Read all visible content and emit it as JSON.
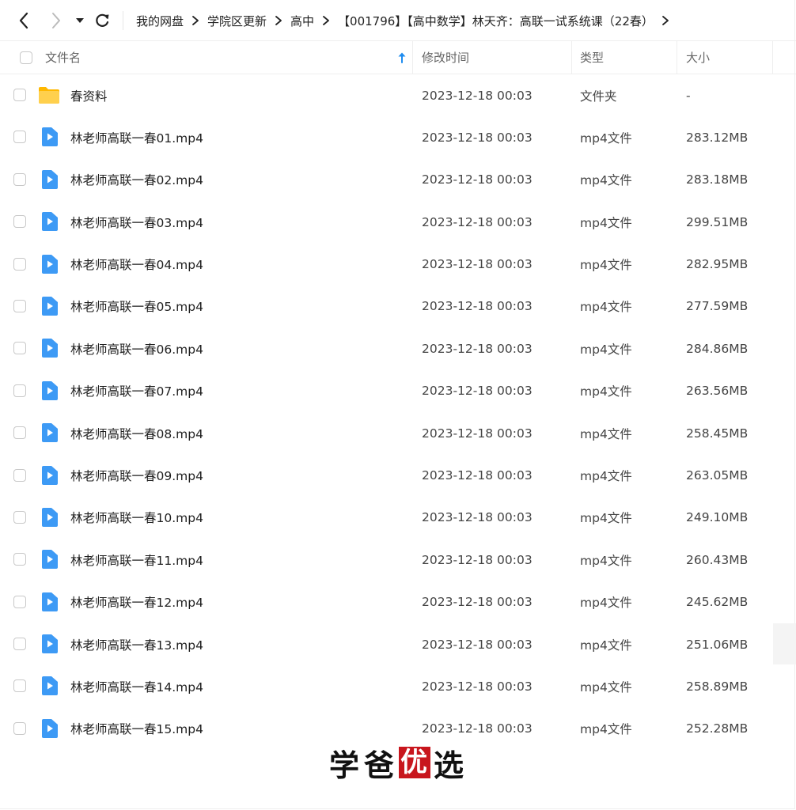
{
  "navigation": {
    "back_icon": "chevron-left-icon",
    "forward_icon": "chevron-right-icon",
    "history_icon": "caret-down-icon",
    "refresh_icon": "refresh-icon"
  },
  "breadcrumb": [
    "我的网盘",
    "学院区更新",
    "高中",
    "【001796】【高中数学】林天齐：高联一试系统课（22春）"
  ],
  "columns": {
    "name": "文件名",
    "modified": "修改时间",
    "type": "类型",
    "size": "大小"
  },
  "files": [
    {
      "name": "春资料",
      "modified": "2023-12-18 00:03",
      "type": "文件夹",
      "size": "-",
      "icon": "folder-icon"
    },
    {
      "name": "林老师高联一春01.mp4",
      "modified": "2023-12-18 00:03",
      "type": "mp4文件",
      "size": "283.12MB",
      "icon": "video-file-icon"
    },
    {
      "name": "林老师高联一春02.mp4",
      "modified": "2023-12-18 00:03",
      "type": "mp4文件",
      "size": "283.18MB",
      "icon": "video-file-icon"
    },
    {
      "name": "林老师高联一春03.mp4",
      "modified": "2023-12-18 00:03",
      "type": "mp4文件",
      "size": "299.51MB",
      "icon": "video-file-icon"
    },
    {
      "name": "林老师高联一春04.mp4",
      "modified": "2023-12-18 00:03",
      "type": "mp4文件",
      "size": "282.95MB",
      "icon": "video-file-icon"
    },
    {
      "name": "林老师高联一春05.mp4",
      "modified": "2023-12-18 00:03",
      "type": "mp4文件",
      "size": "277.59MB",
      "icon": "video-file-icon"
    },
    {
      "name": "林老师高联一春06.mp4",
      "modified": "2023-12-18 00:03",
      "type": "mp4文件",
      "size": "284.86MB",
      "icon": "video-file-icon"
    },
    {
      "name": "林老师高联一春07.mp4",
      "modified": "2023-12-18 00:03",
      "type": "mp4文件",
      "size": "263.56MB",
      "icon": "video-file-icon"
    },
    {
      "name": "林老师高联一春08.mp4",
      "modified": "2023-12-18 00:03",
      "type": "mp4文件",
      "size": "258.45MB",
      "icon": "video-file-icon"
    },
    {
      "name": "林老师高联一春09.mp4",
      "modified": "2023-12-18 00:03",
      "type": "mp4文件",
      "size": "263.05MB",
      "icon": "video-file-icon"
    },
    {
      "name": "林老师高联一春10.mp4",
      "modified": "2023-12-18 00:03",
      "type": "mp4文件",
      "size": "249.10MB",
      "icon": "video-file-icon"
    },
    {
      "name": "林老师高联一春11.mp4",
      "modified": "2023-12-18 00:03",
      "type": "mp4文件",
      "size": "260.43MB",
      "icon": "video-file-icon"
    },
    {
      "name": "林老师高联一春12.mp4",
      "modified": "2023-12-18 00:03",
      "type": "mp4文件",
      "size": "245.62MB",
      "icon": "video-file-icon"
    },
    {
      "name": "林老师高联一春13.mp4",
      "modified": "2023-12-18 00:03",
      "type": "mp4文件",
      "size": "251.06MB",
      "icon": "video-file-icon"
    },
    {
      "name": "林老师高联一春14.mp4",
      "modified": "2023-12-18 00:03",
      "type": "mp4文件",
      "size": "258.89MB",
      "icon": "video-file-icon"
    },
    {
      "name": "林老师高联一春15.mp4",
      "modified": "2023-12-18 00:03",
      "type": "mp4文件",
      "size": "252.28MB",
      "icon": "video-file-icon"
    }
  ],
  "watermark": {
    "chars": [
      "学",
      "爸",
      "优",
      "选"
    ]
  },
  "colors": {
    "accent": "#1e8cf0",
    "folder": "#ffc53d",
    "watermark_red": "#c8161d"
  }
}
